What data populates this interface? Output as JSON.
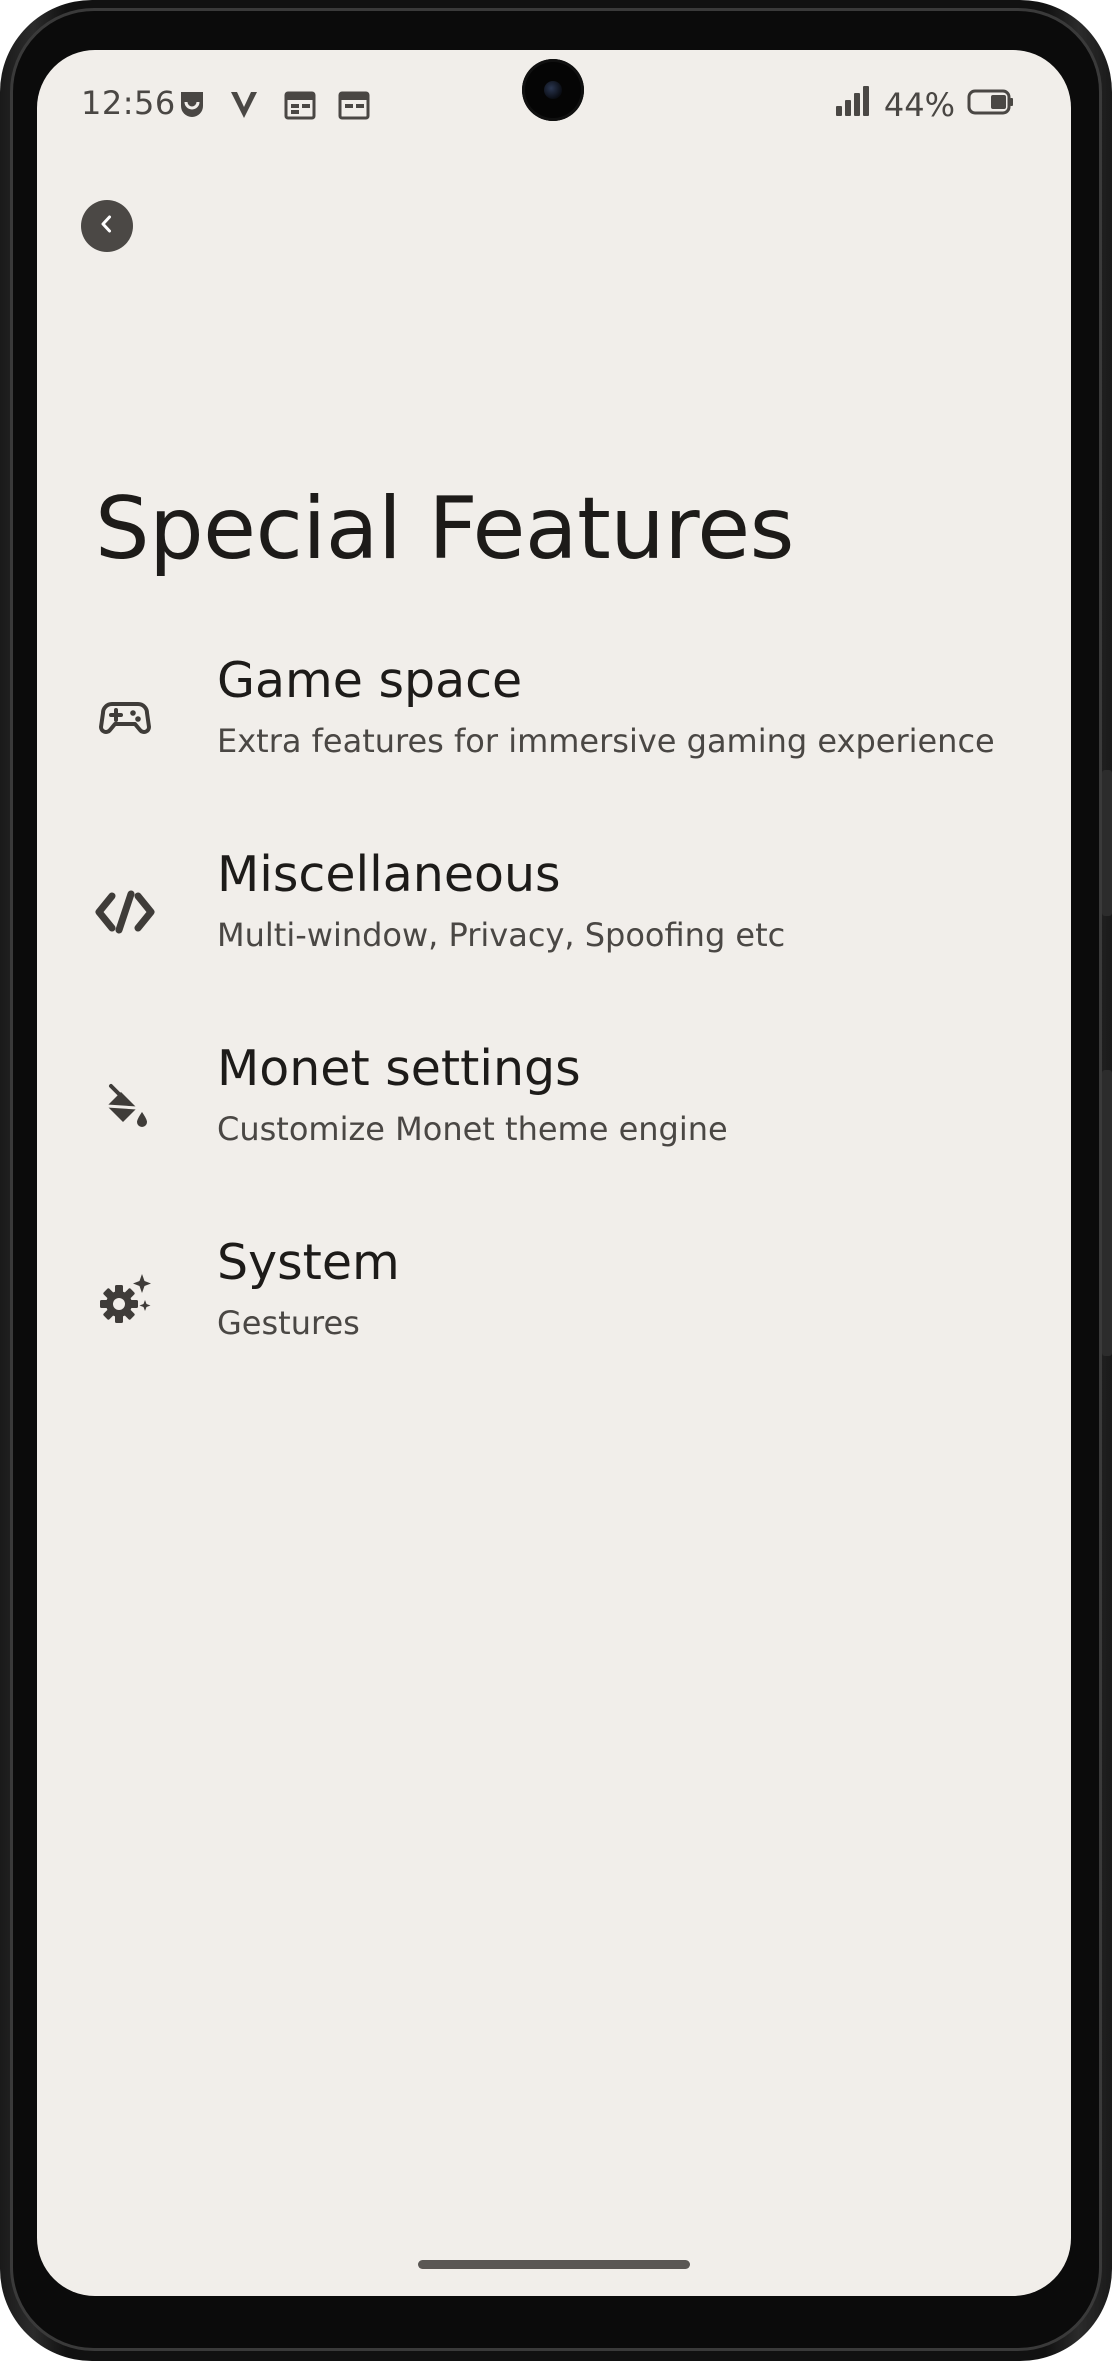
{
  "status_bar": {
    "time": "12:56",
    "battery": "44%",
    "icons": [
      "notification-app-icon",
      "v-app-icon",
      "calendar-icon",
      "calendar-icon",
      "signal-icon",
      "battery-icon"
    ]
  },
  "header": {
    "back_icon": "chevron-left-icon",
    "title": "Special Features"
  },
  "menu": [
    {
      "icon": "gamepad-icon",
      "title": "Game space",
      "subtitle": "Extra features for immersive gaming experience"
    },
    {
      "icon": "code-icon",
      "title": "Miscellaneous",
      "subtitle": "Multi-window, Privacy, Spoofing etc"
    },
    {
      "icon": "paint-bucket-icon",
      "title": "Monet settings",
      "subtitle": "Customize Monet theme engine"
    },
    {
      "icon": "sparkle-gear-icon",
      "title": "System",
      "subtitle": "Gestures"
    }
  ],
  "colors": {
    "background": "#f1eeea",
    "text_primary": "#1d1b19",
    "text_secondary": "#4a4744",
    "icon": "#3f3c39"
  }
}
